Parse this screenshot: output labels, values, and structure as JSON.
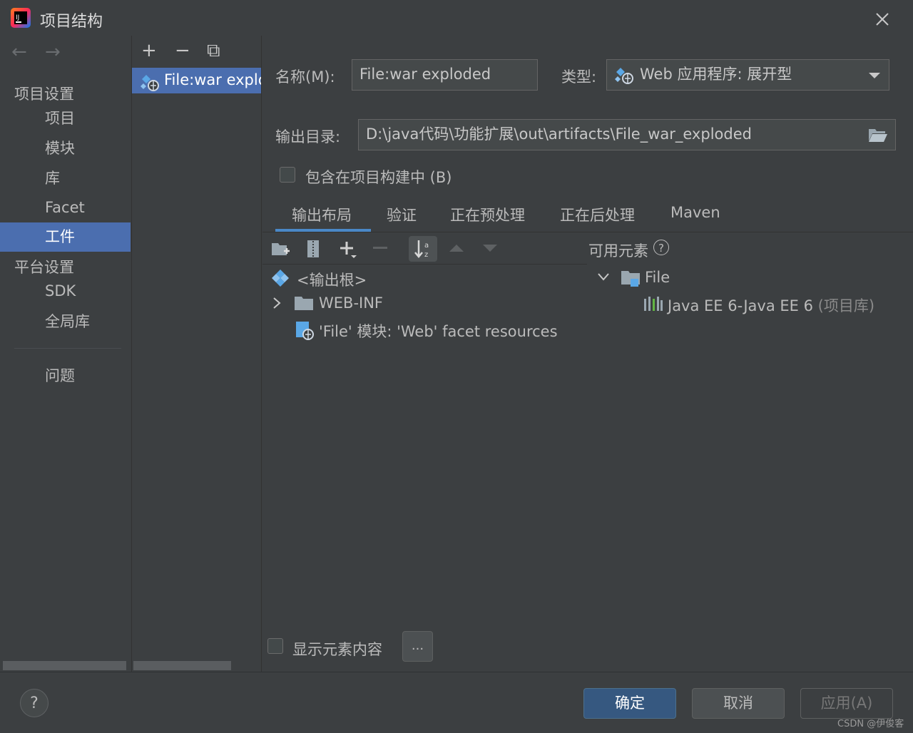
{
  "window": {
    "title": "项目结构"
  },
  "nav": {
    "back": "←",
    "forward": "→"
  },
  "sidebar": {
    "project_settings_header": "项目设置",
    "project_items": [
      "项目",
      "模块",
      "库",
      "Facet",
      "工件"
    ],
    "platform_settings_header": "平台设置",
    "platform_items": [
      "SDK",
      "全局库"
    ],
    "problems": "问题",
    "selected": "工件"
  },
  "artifacts": {
    "toolbar": {
      "add": "+",
      "remove": "−",
      "copy": "⧉"
    },
    "items": [
      "File:war exploded"
    ]
  },
  "form": {
    "name_label": "名称(M):",
    "name_value": "File:war exploded",
    "type_label": "类型:",
    "type_value": "Web 应用程序: 展开型",
    "output_dir_label": "输出目录:",
    "output_dir_value": "D:\\java代码\\功能扩展\\out\\artifacts\\File_war_exploded",
    "include_in_build_label": "包含在项目构建中 (B)"
  },
  "tabs": [
    "输出布局",
    "验证",
    "正在预处理",
    "正在后处理",
    "Maven"
  ],
  "layout_tree": {
    "root": "<输出根>",
    "items": [
      "WEB-INF",
      "'File' 模块: 'Web' facet resources"
    ]
  },
  "available": {
    "header": "可用元素",
    "help": "?",
    "root": "File",
    "library": "Java EE 6-Java EE 6",
    "library_suffix": "(项目库)"
  },
  "bottom_options": {
    "show_content_label": "显示元素内容",
    "more_button": "..."
  },
  "buttons": {
    "help": "?",
    "ok": "确定",
    "cancel": "取消",
    "apply": "应用(A)"
  },
  "watermark": "CSDN @伊俊客",
  "colors": {
    "accent": "#4b6eaf",
    "background": "#3c3f41",
    "ok_button": "#365880"
  }
}
